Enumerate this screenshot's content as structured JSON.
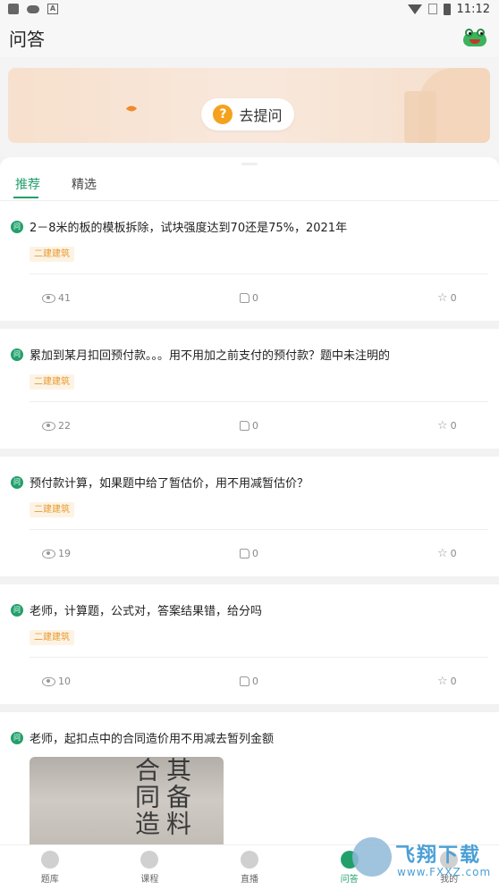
{
  "status_bar": {
    "time": "11:12",
    "sim_label": "A"
  },
  "header": {
    "title": "问答"
  },
  "banner": {
    "ask_button_label": "去提问",
    "ask_button_icon": "?"
  },
  "tabs": [
    {
      "label": "推荐",
      "active": true
    },
    {
      "label": "精选",
      "active": false
    }
  ],
  "question_badge": "问",
  "questions": [
    {
      "title": "2－8米的板的模板拆除，试块强度达到70还是75%，2021年",
      "tag": "二建建筑",
      "views": "41",
      "likes": "0",
      "favorites": "0"
    },
    {
      "title": "累加到某月扣回预付款。。。用不用加之前支付的预付款？题中未注明的",
      "tag": "二建建筑",
      "views": "22",
      "likes": "0",
      "favorites": "0"
    },
    {
      "title": "预付款计算，如果题中给了暂估价，用不用减暂估价？",
      "tag": "二建建筑",
      "views": "19",
      "likes": "0",
      "favorites": "0"
    },
    {
      "title": "老师，计算题，公式对，答案结果错，给分吗",
      "tag": "二建建筑",
      "views": "10",
      "likes": "0",
      "favorites": "0"
    },
    {
      "title": "老师，起扣点中的合同造价用不用减去暂列金额",
      "photo_text_1": "其备料",
      "photo_text_2": "合同造"
    }
  ],
  "bottom_nav": [
    {
      "label": "题库",
      "icon": "pencil-icon",
      "active": false
    },
    {
      "label": "课程",
      "icon": "play-icon",
      "active": false
    },
    {
      "label": "直播",
      "icon": "mic-icon",
      "active": false
    },
    {
      "label": "问答",
      "icon": "question-bubble-icon",
      "active": true
    },
    {
      "label": "我的",
      "icon": "profile-icon",
      "active": false
    }
  ],
  "watermark": {
    "title": "飞翔下载",
    "subtitle": "www.FXXZ.com"
  },
  "colors": {
    "accent": "#22a06b",
    "tag_text": "#e69a2e",
    "tag_bg": "#fdf3e4"
  }
}
